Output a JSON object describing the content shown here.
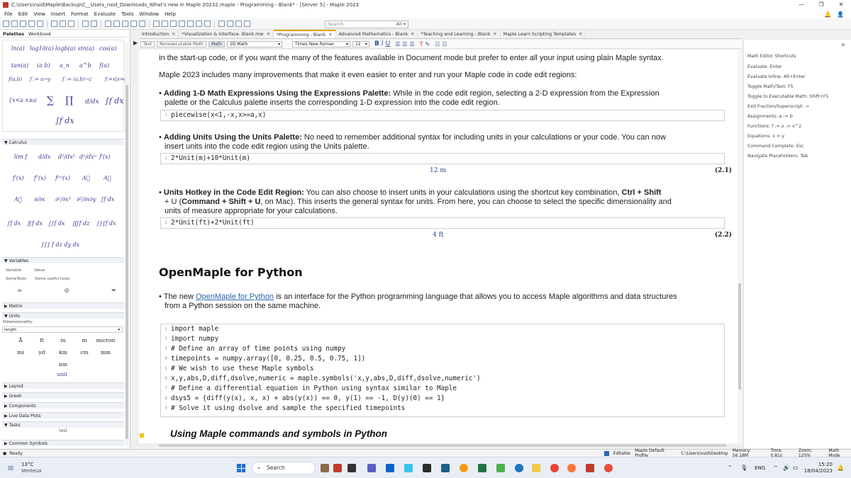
{
  "window": {
    "title": "C:\\Users\\nsid\\Maple\\Backup\\C__Users_nsid_Downloads_What's new in Maple 20232.maple - Programming - Blank* - [Server 5] - Maple 2023",
    "controls": [
      "—",
      "❐",
      "✕"
    ]
  },
  "menu": [
    "File",
    "Edit",
    "View",
    "Insert",
    "Format",
    "Evaluate",
    "Tools",
    "Window",
    "Help"
  ],
  "search": {
    "placeholder": "Search",
    "scope": "All"
  },
  "left_panel": {
    "tabs": [
      "Palettes",
      "Workbook"
    ],
    "expression_items": [
      "ln(a)",
      "log10(a)",
      "logb(a)",
      "sin(a)",
      "cos(a)",
      "tan(a)",
      "(a b)",
      "a_n",
      "a^b",
      "f(a)",
      "f(a,b)",
      "f := a→y",
      "f := (a,b)→z",
      "f:=x|x=a"
    ],
    "calculus_header": "Calculus",
    "variables_header": "Variables",
    "variables_columns": [
      "Variable",
      "Value"
    ],
    "variables_row": [
      "SomeTools",
      "Some useful tools"
    ],
    "matrix_header": "Matrix",
    "units_header": "Units",
    "dimensionality_label": "Dimensionality:",
    "dimensionality_value": "length",
    "units": [
      "Å",
      "ft",
      "in",
      "m",
      "micron",
      "mi",
      "yd",
      "km",
      "cm",
      "mm",
      "nm"
    ],
    "unit_label": "unit",
    "collapsed": [
      "Layout",
      "Greek",
      "Components",
      "Live Data Plots",
      "Tasks"
    ],
    "tasks_item": "test",
    "common_symbols": "Common Symbols"
  },
  "doc_tabs": [
    {
      "label": "Introduction",
      "active": false
    },
    {
      "label": "*Visualization & Interface- Blank.mw",
      "active": false
    },
    {
      "label": "*Programming - Blank",
      "active": true
    },
    {
      "label": "Advanced Mathematics - Blank",
      "active": false
    },
    {
      "label": "*Teaching and Learning - Blank",
      "active": false
    },
    {
      "label": "Maple Learn Scripting Templates",
      "active": false
    }
  ],
  "context_bar": {
    "text_btn": "Text",
    "nonexec_btn": "Nonexecutable Math",
    "math_btn": "Math",
    "mode": "2D Math",
    "font": "Times New Roman",
    "size": "12"
  },
  "document": {
    "intro_line": "in the start-up code, or if you want the many of the features available in Document mode but prefer to enter all your input using plain Maple syntax.",
    "improvements": "Maple 2023 includes many improvements that make it even easier to enter and run your Maple code in code edit regions:",
    "b1_title": "Adding 1-D Math Expressions Using the Expressions Palette:",
    "b1_text_a": " While in the code edit region, selecting a 2-D expression from the Expression",
    "b1_text_b": "palette or the Calculus palette inserts the corresponding 1-D expression into the code edit region.",
    "code1": "piecewise(x<1,-x,x>=a,x)",
    "b2_title": "Adding Units Using the Units Palette:",
    "b2_text_a": " No need to remember additional syntax for including units in your calculations or your code. You can now",
    "b2_text_b": "insert units into the code edit region using the Units palette.",
    "code2": "2*Unit(m)+10*Unit(m)",
    "out2": "12 m",
    "eq2": "(2.1)",
    "b3_title": "Units Hotkey in the Code Edit Region:",
    "b3_text_a": "  You can also choose to insert units in your calculations using the shortcut key combination, ",
    "b3_hotkey": "Ctrl + Shift",
    "b3_line2_a": "+ U (",
    "b3_hotkey2": "Command + Shift + U",
    "b3_line2_b": ", on Mac). This inserts the general syntax for units. From here, you can choose to select the specific dimensionality and",
    "b3_line3": "units of measure appropriate for your calculations.",
    "code3": "2*Unit(ft)+2*Unit(ft)",
    "out3": "4 ft",
    "eq3": "(2.2)",
    "section_title": "OpenMaple for Python",
    "om_prefix": "The new ",
    "om_link": "OpenMaple for Python",
    "om_text_a": " is an interface for the Python programming language that allows you to access Maple algorithms and data structures",
    "om_text_b": "from a Python session on the same machine.",
    "python_lines": [
      "import maple",
      "import numpy",
      "# Define an array of time points using numpy",
      "timepoints = numpy.array([0, 0.25, 0.5, 0.75, 1])",
      "# We wish to use these Maple symbols",
      "x,y,abs,D,diff,dsolve,numeric = maple.symbols('x,y,abs,D,diff,dsolve,numeric')",
      "# Define a differential equation in Python using syntax similar to Maple",
      "dsys5 = {diff(y(x), x, x) + abs(y(x)) == 0, y(1) == -1, D(y)(0) == 1}",
      "# Solve it using dsolve and sample the specified timepoints"
    ],
    "subsection": "Using Maple commands and symbols in Python"
  },
  "right_panel": {
    "title": "Math Editor Shortcuts",
    "items": [
      "Evaluate: Enter",
      "Evaluate Inline: Alt+Enter",
      "Toggle Math/Text: F5",
      "Toggle to Executable Math: Shift+F5",
      "Exit Fraction/Superscript: →",
      "Assignments: a := b",
      "Functions: f := x -> x^2",
      "Equations: x = y",
      "Command Complete: Esc",
      "Navigate Placeholders: Tab"
    ]
  },
  "status": {
    "ready": "Ready",
    "editable": "Editable",
    "profile": "Maple Default Profile",
    "path": "C:\\Users\\nsid\\Desktop",
    "memory": "Memory: 56.18M",
    "time": "Time: 0.81s",
    "zoom": "Zoom: 125%",
    "mode": "Math Mode"
  },
  "taskbar": {
    "temp": "13°C",
    "weather": "Venteux",
    "search": "Search",
    "lang": "ENG",
    "clock_time": "15:20",
    "clock_date": "18/04/2023"
  }
}
